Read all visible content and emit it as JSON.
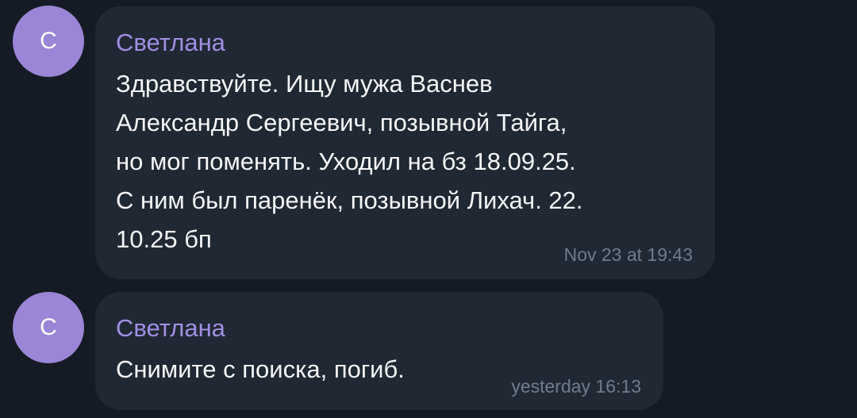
{
  "messages": [
    {
      "avatar_letter": "С",
      "sender": "Светлана",
      "lines": [
        "Здравствуйте. Ищу мужа Васнев",
        "Александр Сергеевич, позывной Тайга,",
        "но мог поменять. Уходил на бз 18.09.25.",
        "С ним был паренёк, позывной Лихач. 22.",
        "10.25 бп"
      ],
      "time": "Nov 23 at 19:43"
    },
    {
      "avatar_letter": "С",
      "sender": "Светлана",
      "lines": [
        "Снимите с поиска, погиб."
      ],
      "time": "yesterday 16:13"
    }
  ],
  "colors": {
    "background": "#151b24",
    "bubble": "#202833",
    "avatar": "#9b85d6",
    "sender": "#9f8fe3",
    "text": "#f4f6f8",
    "time": "#6e7c8a"
  }
}
